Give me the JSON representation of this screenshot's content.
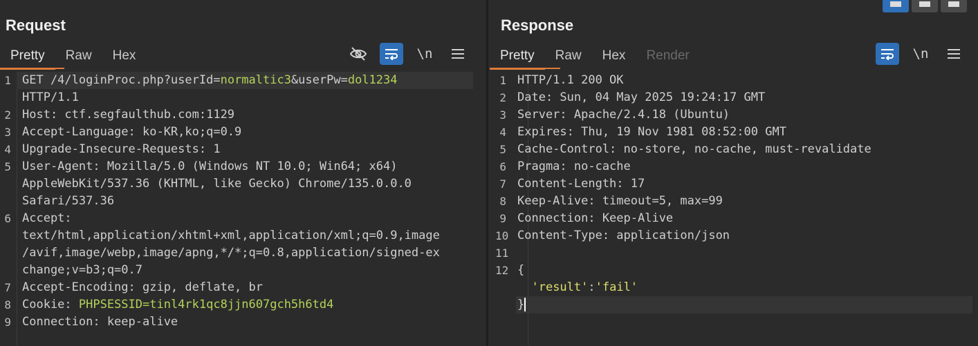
{
  "request": {
    "title": "Request",
    "tabs": [
      {
        "label": "Pretty"
      },
      {
        "label": "Raw"
      },
      {
        "label": "Hex"
      }
    ],
    "newline_label": "\\n",
    "lines": [
      {
        "n": "1",
        "parts": [
          [
            "k",
            "GET /4/loginProc.php?userId="
          ],
          [
            "v",
            "normaltic3"
          ],
          [
            "k",
            "&userPw="
          ],
          [
            "v",
            "dol1234"
          ]
        ]
      },
      {
        "n": "",
        "parts": [
          [
            "k",
            "HTTP/1.1"
          ]
        ]
      },
      {
        "n": "2",
        "parts": [
          [
            "k",
            "Host: ctf.segfaulthub.com:1129"
          ]
        ]
      },
      {
        "n": "3",
        "parts": [
          [
            "k",
            "Accept-Language: ko-KR,ko;q=0.9"
          ]
        ]
      },
      {
        "n": "4",
        "parts": [
          [
            "k",
            "Upgrade-Insecure-Requests: 1"
          ]
        ]
      },
      {
        "n": "5",
        "parts": [
          [
            "k",
            "User-Agent: Mozilla/5.0 (Windows NT 10.0; Win64; x64)"
          ]
        ]
      },
      {
        "n": "",
        "parts": [
          [
            "k",
            "AppleWebKit/537.36 (KHTML, like Gecko) Chrome/135.0.0.0"
          ]
        ]
      },
      {
        "n": "",
        "parts": [
          [
            "k",
            "Safari/537.36"
          ]
        ]
      },
      {
        "n": "6",
        "parts": [
          [
            "k",
            "Accept:"
          ]
        ]
      },
      {
        "n": "",
        "parts": [
          [
            "k",
            "text/html,application/xhtml+xml,application/xml;q=0.9,image"
          ]
        ]
      },
      {
        "n": "",
        "parts": [
          [
            "k",
            "/avif,image/webp,image/apng,*/*;q=0.8,application/signed-ex"
          ]
        ]
      },
      {
        "n": "",
        "parts": [
          [
            "k",
            "change;v=b3;q=0.7"
          ]
        ]
      },
      {
        "n": "7",
        "parts": [
          [
            "k",
            "Accept-Encoding: gzip, deflate, br"
          ]
        ]
      },
      {
        "n": "8",
        "parts": [
          [
            "k",
            "Cookie: "
          ],
          [
            "v",
            "PHPSESSID=tinl4rk1qc8jjn607gch5h6td4"
          ]
        ]
      },
      {
        "n": "9",
        "parts": [
          [
            "k",
            "Connection: keep-alive"
          ]
        ]
      }
    ]
  },
  "response": {
    "title": "Response",
    "tabs": [
      {
        "label": "Pretty"
      },
      {
        "label": "Raw"
      },
      {
        "label": "Hex"
      },
      {
        "label": "Render"
      }
    ],
    "newline_label": "\\n",
    "lines": [
      {
        "n": "1",
        "parts": [
          [
            "k",
            "HTTP/1.1 200 OK"
          ]
        ]
      },
      {
        "n": "2",
        "parts": [
          [
            "k",
            "Date: Sun, 04 May 2025 19:24:17 GMT"
          ]
        ]
      },
      {
        "n": "3",
        "parts": [
          [
            "k",
            "Server: Apache/2.4.18 (Ubuntu)"
          ]
        ]
      },
      {
        "n": "4",
        "parts": [
          [
            "k",
            "Expires: Thu, 19 Nov 1981 08:52:00 GMT"
          ]
        ]
      },
      {
        "n": "5",
        "parts": [
          [
            "k",
            "Cache-Control: no-store, no-cache, must-revalidate"
          ]
        ]
      },
      {
        "n": "6",
        "parts": [
          [
            "k",
            "Pragma: no-cache"
          ]
        ]
      },
      {
        "n": "7",
        "parts": [
          [
            "k",
            "Content-Length: 17"
          ]
        ]
      },
      {
        "n": "8",
        "parts": [
          [
            "k",
            "Keep-Alive: timeout=5, max=99"
          ]
        ]
      },
      {
        "n": "9",
        "parts": [
          [
            "k",
            "Connection: Keep-Alive"
          ]
        ]
      },
      {
        "n": "10",
        "parts": [
          [
            "k",
            "Content-Type: application/json"
          ]
        ]
      },
      {
        "n": "11",
        "parts": [
          [
            "k",
            ""
          ]
        ]
      },
      {
        "n": "12",
        "parts": [
          [
            "k",
            "{"
          ]
        ]
      },
      {
        "n": "",
        "parts": [
          [
            "k",
            "  "
          ],
          [
            "s",
            "'result'"
          ],
          [
            "k",
            ":"
          ],
          [
            "s",
            "'fail'"
          ]
        ]
      },
      {
        "n": "",
        "parts": [
          [
            "k",
            "}"
          ]
        ]
      }
    ]
  }
}
